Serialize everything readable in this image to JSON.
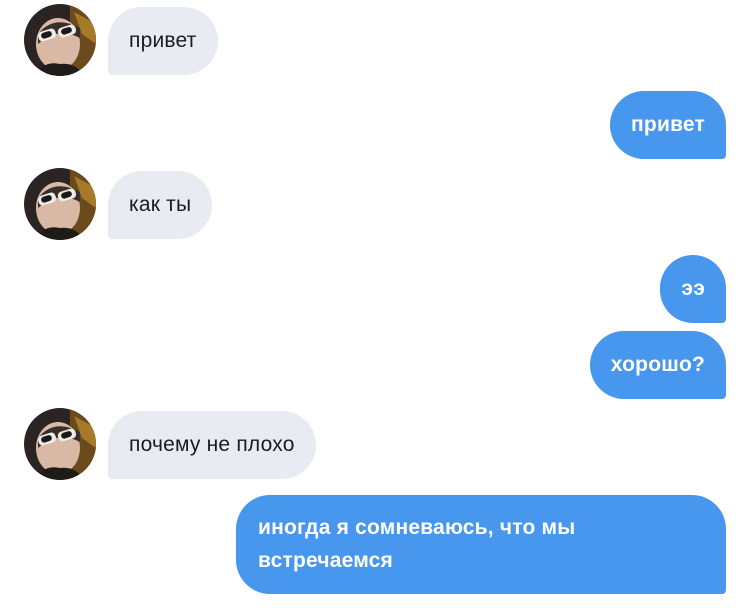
{
  "conversation": {
    "messages": [
      {
        "side": "incoming",
        "text": "привет"
      },
      {
        "side": "outgoing",
        "text": "привет"
      },
      {
        "side": "incoming",
        "text": "как ты"
      },
      {
        "side": "outgoing",
        "text": "ээ"
      },
      {
        "side": "outgoing",
        "text": "хорошо?"
      },
      {
        "side": "incoming",
        "text": "почему не плохо"
      },
      {
        "side": "outgoing",
        "text": "иногда я сомневаюсь, что мы встречаемся"
      }
    ]
  },
  "colors": {
    "incoming_bubble": "#e9ebf2",
    "incoming_text": "#1c1c1e",
    "outgoing_bubble": "#4797ee",
    "outgoing_text": "#ffffff"
  },
  "icons": {
    "avatar": "contact-avatar-photo"
  }
}
